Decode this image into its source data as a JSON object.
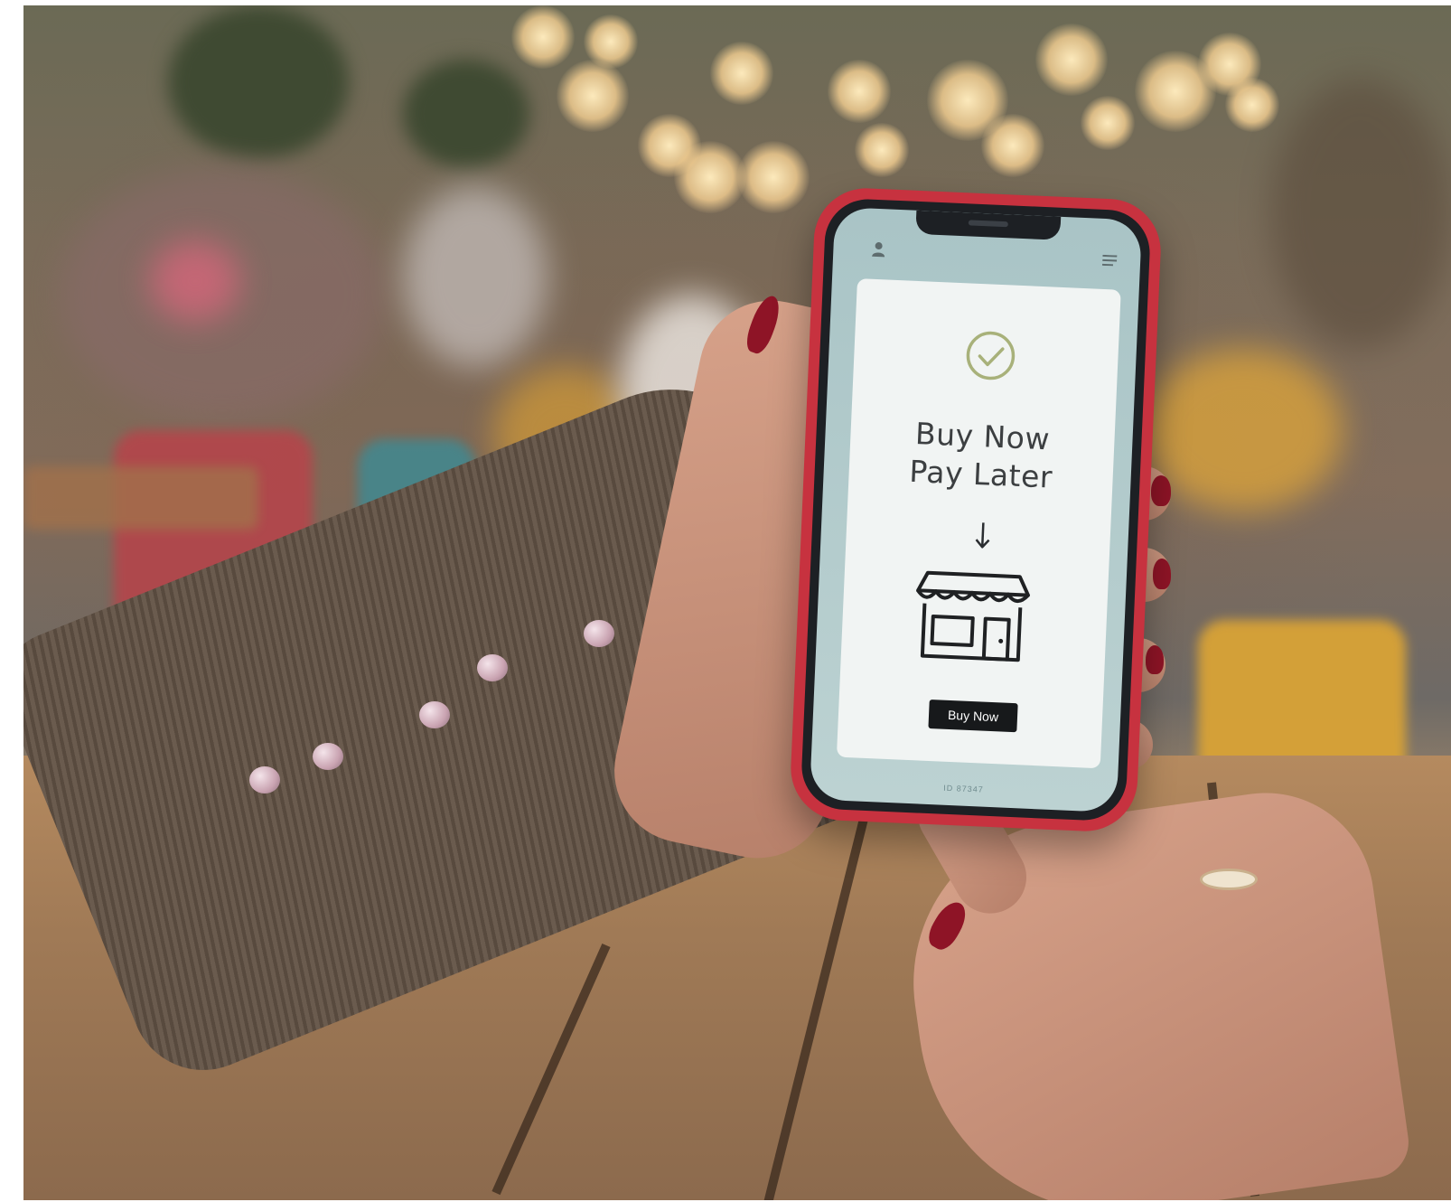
{
  "scene": {
    "colors": {
      "phone_case": "#c7323f",
      "screen_bg": "#bcd2d2",
      "card_bg": "#f1f4f3",
      "check_accent": "#a8b17a",
      "button_bg": "#17191b",
      "nail_polish": "#8e1426"
    }
  },
  "phone_app": {
    "top_bar": {
      "left_icon": "user-icon",
      "right_icon": "menu-icon"
    },
    "card": {
      "status_icon": "check-circle-icon",
      "headline_line1": "Buy Now",
      "headline_line2": "Pay Later",
      "arrow_icon": "arrow-down-icon",
      "illustration_icon": "store-icon",
      "button_label": "Buy Now"
    },
    "footer_text": "ID 87347"
  }
}
